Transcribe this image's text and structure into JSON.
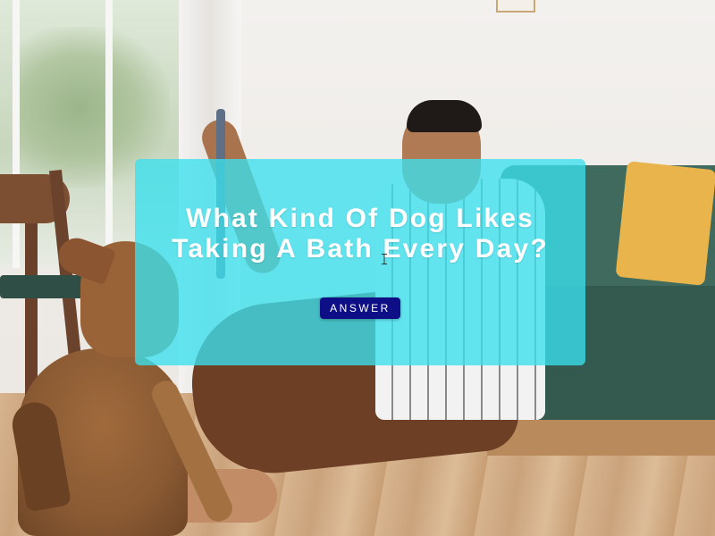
{
  "card": {
    "title": "What Kind Of Dog Likes\nTaking A Bath Every Day?",
    "button_label": "ANSWER",
    "overlay_color": "#3ae0ee",
    "button_color": "#0e0f86"
  },
  "background": {
    "icon_names": [
      "photo-background"
    ]
  },
  "cursor": {
    "icon": "text-cursor-icon"
  }
}
